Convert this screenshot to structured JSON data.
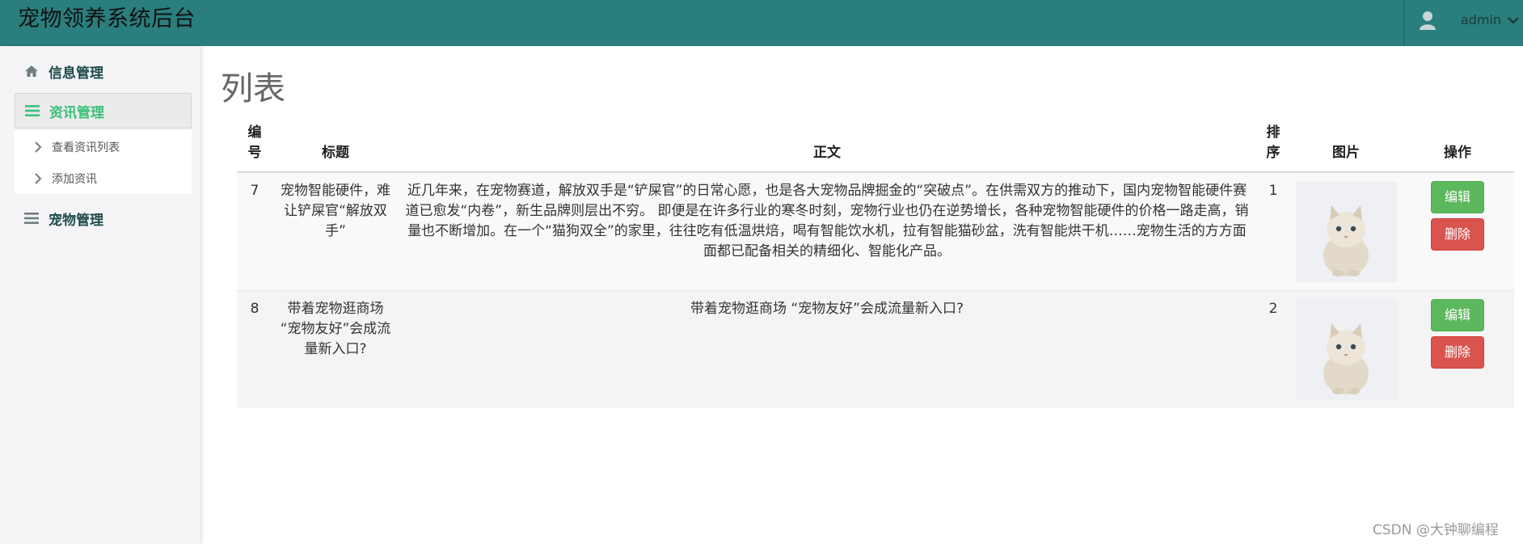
{
  "app": {
    "title": "宠物领养系统后台"
  },
  "user": {
    "name": "admin",
    "icon": "user-icon",
    "caret": "chevron-down-icon"
  },
  "sidebar": {
    "groups": [
      {
        "label": "信息管理",
        "icon": "home-icon",
        "active": false
      },
      {
        "label": "资讯管理",
        "icon": "list-icon",
        "active": true
      },
      {
        "label": "宠物管理",
        "icon": "list-icon",
        "active": false
      }
    ],
    "sub_items": [
      {
        "label": "查看资讯列表"
      },
      {
        "label": "添加资讯"
      }
    ]
  },
  "main": {
    "title": "列表",
    "columns": [
      "编号",
      "标题",
      "正文",
      "排序",
      "图片",
      "操作"
    ],
    "rows": [
      {
        "id": "7",
        "title": "宠物智能硬件，难让铲屎官“解放双手”",
        "body": "近几年来，在宠物赛道，解放双手是“铲屎官”的日常心愿，也是各大宠物品牌掘金的“突破点”。在供需双方的推动下，国内宠物智能硬件赛道已愈发“内卷”，新生品牌则层出不穷。 即便是在许多行业的寒冬时刻，宠物行业也仍在逆势增长，各种宠物智能硬件的价格一路走高，销量也不断增加。在一个“猫狗双全”的家里，往往吃有低温烘焙，喝有智能饮水机，拉有智能猫砂盆，洗有智能烘干机……宠物生活的方方面面都已配备相关的精细化、智能化产品。",
        "sort": "1",
        "image": "kitten-photo"
      },
      {
        "id": "8",
        "title": "带着宠物逛商场 “宠物友好”会成流量新入口?",
        "body": "带着宠物逛商场 “宠物友好”会成流量新入口?",
        "sort": "2",
        "image": "kitten-photo"
      }
    ],
    "actions": {
      "edit": "编辑",
      "delete": "删除"
    }
  },
  "watermark": "CSDN @大钟聊编程",
  "colors": {
    "topbar": "#2a7e7e",
    "active_menu": "#3cc07a",
    "edit": "#5cb85c",
    "delete": "#d9534f"
  }
}
